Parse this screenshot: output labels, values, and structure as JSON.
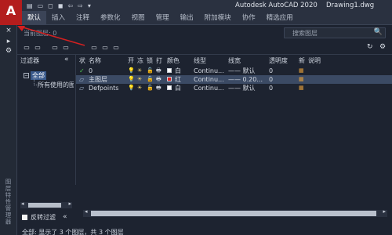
{
  "app": {
    "logo_letter": "A",
    "title": "Autodesk AutoCAD 2020",
    "document": "Drawing1.dwg",
    "quick_access": [
      "▤",
      "▭",
      "◻",
      "◼",
      "⇦",
      "⇨",
      "▾"
    ]
  },
  "ribbon": {
    "tabs": [
      "默认",
      "插入",
      "注释",
      "参数化",
      "视图",
      "管理",
      "输出",
      "附加模块",
      "协作",
      "精选应用"
    ],
    "active_index": 0
  },
  "side_strip": {
    "close_glyph": "×",
    "pin_glyph": "▸",
    "settings_glyph": "⚙",
    "title": "图层特性管理器"
  },
  "palette": {
    "current_layer_label": "当前图层: 0",
    "search_placeholder": "搜索图层",
    "search_icon": "🔍",
    "toolbar_icons_left": [
      "▭",
      "▭",
      "▭",
      "▭",
      "▭",
      "▭",
      "▭"
    ],
    "toolbar_icons_right": [
      "↻",
      "⚙"
    ],
    "filter_header": "过滤器",
    "collapse_glyph": "«",
    "tree": {
      "root_toggle": "−",
      "root_label": "全部",
      "child_label": "所有使用的图层"
    },
    "invert_label": "反转过滤",
    "columns": [
      "状",
      "名称",
      "开",
      "冻",
      "锁",
      "打",
      "颜色",
      "线型",
      "线宽",
      "透明度",
      "新",
      "说明"
    ],
    "rows": [
      {
        "status": "✓",
        "name": "0",
        "on": "💡",
        "freeze": "☀",
        "lock": "🔓",
        "print": "🖶",
        "color_name": "白",
        "color_hex": "#ffffff",
        "linetype": "Continu...",
        "lineweight": "—— 默认",
        "transparency": "0",
        "selected": false
      },
      {
        "status": "▱",
        "name": "主图层",
        "on": "💡",
        "freeze": "☀",
        "lock": "🔓",
        "print": "🖶",
        "color_name": "红",
        "color_hex": "#e02020",
        "linetype": "Continu...",
        "lineweight": "—— 0.20...",
        "transparency": "0",
        "selected": true
      },
      {
        "status": "▱",
        "name": "Defpoints",
        "on": "💡",
        "freeze": "☀",
        "lock": "🔓",
        "print": "🖶",
        "color_name": "白",
        "color_hex": "#ffffff",
        "linetype": "Continu...",
        "lineweight": "—— 默认",
        "transparency": "0",
        "selected": false
      }
    ],
    "status_text": "全部: 显示了 3 个图层，共 3 个图层"
  },
  "colors": {
    "accent_red": "#b31d1d",
    "selection": "#3b4a64",
    "annotation_arrow": "#d42020"
  }
}
